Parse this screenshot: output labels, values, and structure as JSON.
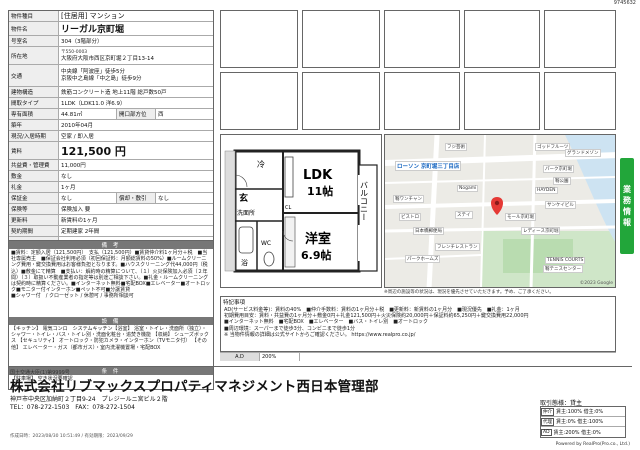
{
  "doc_id": "9745632",
  "spec": {
    "type_label": "物件種目",
    "type_value": "[住居用] マンション",
    "name_label": "物件名",
    "name_value": "リーガル京町堀",
    "room_label": "号室名",
    "room_value": "304（3階部分）",
    "address_label": "所在地",
    "address_zip": "〒550-0003",
    "address_value": "大阪府大阪市西区京町堀２丁目13-14",
    "traffic_label": "交通",
    "traffic_line1": "中央線「阿波座」徒歩5分",
    "traffic_line2": "京阪中之島線「中之島」徒歩9分",
    "structure_label": "建物構造",
    "structure_value": "鉄筋コンクリート造 地上11階 総戸数50戸",
    "layout_label": "間取タイプ",
    "layout_value": "1LDK（LDK11.0 洋6.9）",
    "area_label": "専有面積",
    "area_value": "44.81㎡",
    "opening_label": "開口部方位",
    "opening_value": "西",
    "built_label": "築年",
    "built_value": "2010年04月",
    "status_label": "現況/入居時期",
    "status_value": "空家 / 即入居",
    "rent_label": "賃料",
    "rent_value": "121,500 円",
    "common_label": "共益費・管理費",
    "common_value": "11,000円",
    "deposit_label": "敷金",
    "deposit_value": "なし",
    "keymoney_label": "礼金",
    "keymoney_value": "1ヶ月",
    "guarantee_label": "保証金",
    "guarantee_value": "なし",
    "amortize_label": "償却・敷引",
    "amortize_value": "なし",
    "insurance_label": "保険等",
    "insurance_value": "保険加入 要",
    "renew_label": "更新料",
    "renew_value": "新賃料の1ヶ月",
    "contract_label": "契約期間",
    "contract_value": "定期建家 2年間",
    "parking_label": "駐車場",
    "parking_value": ""
  },
  "notes": {
    "header": "備 考",
    "body": "■賃料：定額入居（121,500円）　支払（121,500円）■賃貸仲介料1ヶ月分＋税　■当社専属売主　■保証会社利用必須（初回保証料：月額総賃料の50%）■ルームクリーニング費用・鍵交換費用はお客様負担となります。■ハウスクリーニング代44,000円（税込）■敷金にて精算　■支払い：解約時の精算について、（１）火災保険加入必須（２年間）（３）取扱い不動産業者の指定等は別途ご相談下さい。■礼金・ルームクリーニングは契約時に精算ください。■インターネット無料■宅配BOX■エレベーター■オートロック■モニター付インターホン■ペット不可■分譲賃貸",
    "tail": "■シャワー付　/ クローゼット / 休憩可 / 事務所相談可"
  },
  "equipment": {
    "header": "設 備",
    "body": "【キッチン】 電気コンロ　システムキッチン【浴室】 浴室・トイレ・洗面所（独立）・シャワー・トイレ・バス・トイレ別・洗面化粧台・追焚き機能 【収納】 シューズボックス 【セキュリティ】 オートロック・防犯カメラ・インターホン（TVモニタ付） 【その他】 エレベーター・ガス（都市ガス）・室内洗濯機置場・宅配BOX"
  },
  "conditions": {
    "header": "条 件",
    "body": "【駐車場】 空き状況要確認"
  },
  "floorplan": {
    "ldk": "LDK",
    "ldk_size": "11帖",
    "western": "洋室",
    "western_size": "6.9帖",
    "balcony": "バルコニー",
    "entrance": "玄",
    "washroom": "洗面所",
    "bath": "浴",
    "wc": "WC",
    "closet": "CL",
    "fridge": "冷"
  },
  "map": {
    "labels": [
      "ローソン 京町堀三丁目店",
      "フジ芸術",
      "ゴッドフルーツ",
      "パーク京町堀",
      "靱公園",
      "HAYDEN",
      "Nogami",
      "日本橋郵便局",
      "靱ワンチャン",
      "フレンチレストラン",
      "パークホームズ",
      "ステイ",
      "グランドメゾン",
      "モール京町堀",
      "サンケイビル",
      "レディース京町堀",
      "ビストロ",
      "TENNIS COURTS",
      "靱テニスセンター"
    ],
    "copyright": "©2023 Google",
    "caption": "※周辺の施設等の状況は、現況を優先させていただきます。予め、ご了承ください。"
  },
  "memo": {
    "header": "特記事項",
    "body_lines": [
      "AD(サービス料金等)：賃料の40%　■仲介手数料：賃料の1ヶ月分＋税　■更新料：新賃料の1ヶ月分　■現況優先　■礼金：1ヶ月",
      "初期費用目安：賃料・共益費の1ヶ月分＋敷金0円＋礼金121,500円＋火災保険約20,000円＋保証料約65,250円＋鍵交換費用22,000円",
      "■インターネット無料　■宅配BOX　■エレベーター　■バス・トイレ別　■オートロック",
      "■周辺環境：スーパーまで徒歩3分、コンビニまで徒歩1分",
      "※ 当物件情報の詳細は公式サイトからご確認ください。  https://www.realpro.co.jp/"
    ]
  },
  "scale": {
    "a_label": "A.D",
    "a_value": "200%"
  },
  "sidetab": [
    "業",
    "務",
    "情",
    "報"
  ],
  "agent": {
    "license": "国土交通大臣(1)第9999号",
    "name": "株式会社リブマックスプロパティマネジメント西日本管理部",
    "address": "神戸市中央区加納町２丁目9-24　プレジールニ宮ビル２階",
    "tel_fax": "TEL：078-272-1503　FAX：078-272-1504"
  },
  "terms": {
    "title": "取引態様：貸主",
    "rows": [
      {
        "badge": "仲介",
        "text": "賃主:100% 借主:0%"
      },
      {
        "badge": "代理",
        "text": "賃主:0% 借主:100%"
      },
      {
        "badge": "AD",
        "text": "賃主:200% 借主:0%"
      }
    ]
  },
  "footer": {
    "timestamp": "作成日時：2023/08/30 10:51:49 / 有効期限：2023/09/29",
    "powered": "Powered by RealPro(Pro.co., Ltd.)"
  }
}
